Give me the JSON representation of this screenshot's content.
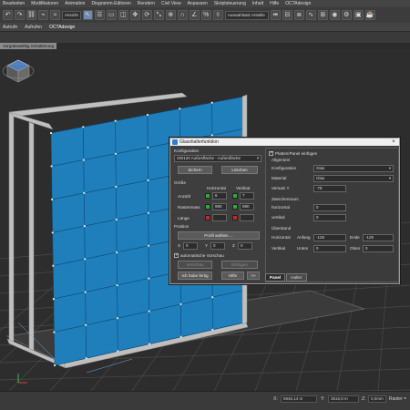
{
  "menubar": {
    "items": [
      "Bearbeiten",
      "Modifikatoren",
      "Animation",
      "Diagramm-Editoren",
      "Rendern",
      "Civil View",
      "Anpassen",
      "Skriptsteuerung",
      "Inhalt",
      "Hilfe",
      "OCTAdesign"
    ]
  },
  "toolbar": {
    "filter_dropdown": "Ansicht",
    "selection_set": "Auswahlsatz erstelle"
  },
  "ribbon": {
    "tabs": [
      "Autrufe",
      "Aufrufen",
      "OCTAdesign"
    ]
  },
  "viewport": {
    "label": "Vorgabewählig Schattierung"
  },
  "dialog": {
    "title": "Glasshalterfunktion",
    "close": "×",
    "left": {
      "konfiguration_label": "Konfiguration",
      "konfiguration_value": "SW120 Außenfläche - Außenfläche",
      "speichern": "Sichern",
      "loeschen": "Löschen",
      "groesse_label": "Größe",
      "horizontal": "Horizontal",
      "vertikal": "Vertikal",
      "anzahl_label": "Anzahl",
      "anzahl_h": "6",
      "anzahl_v": "7",
      "rastermass_label": "Rastermass",
      "rastermass_h": "990",
      "rastermass_v": "990",
      "laenge_label": "Länge",
      "position_label": "Position",
      "profil_waehlen": "Profil wählen ...",
      "x_label": "X",
      "x_value": "0",
      "y_label": "Y",
      "y_value": "0",
      "z_label": "Z",
      "z_value": "0",
      "auto_vorschau": "automatische Vorschau",
      "vorschau": "Vorschau",
      "einfuegen": "Einfügen",
      "ich_habe_fertig": "Ich habe fertig",
      "hilfe": "Hilfe",
      "more": ">>"
    },
    "right": {
      "platten_check": "Platten/Panel einfügen",
      "allgemein": "Allgemein",
      "konfiguration_label": "Konfiguration",
      "konfiguration_value": "Glas",
      "material_label": "Material",
      "material_value": "Glas",
      "versatz_label": "Versatz Y",
      "versatz_value": "-78",
      "zwischenraum_label": "Zwischenraum",
      "horizontal_label": "horizontal",
      "horizontal_value": "0",
      "vertikal_label": "vertikal",
      "vertikal_value": "0",
      "ueberstand_label": "Überstand",
      "ue_horizontal_label": "Horizontal",
      "anfang_label": "Anfang",
      "anfang_value": "-125",
      "ende_label": "Ende",
      "ende_value": "-125",
      "ue_vertikal_label": "Vertikal",
      "unten_label": "Unten",
      "unten_value": "0",
      "oben_label": "Oben",
      "oben_value": "0"
    },
    "tabs": [
      "Panel",
      "Halter"
    ]
  },
  "statusbar": {
    "x_label": "X:",
    "x_value": "5946,14 m",
    "y_label": "Y:",
    "y_value": "3516,8 m",
    "z_label": "Z:",
    "z_value": "0,0mm",
    "raster_label": "Raster ="
  },
  "colors": {
    "panel_blue": "#1f7fba",
    "frame_grey": "#bfbfbf",
    "grid_line": "#4a4a4a",
    "check_green": "#2fa83a",
    "lock_red": "#c62828"
  }
}
